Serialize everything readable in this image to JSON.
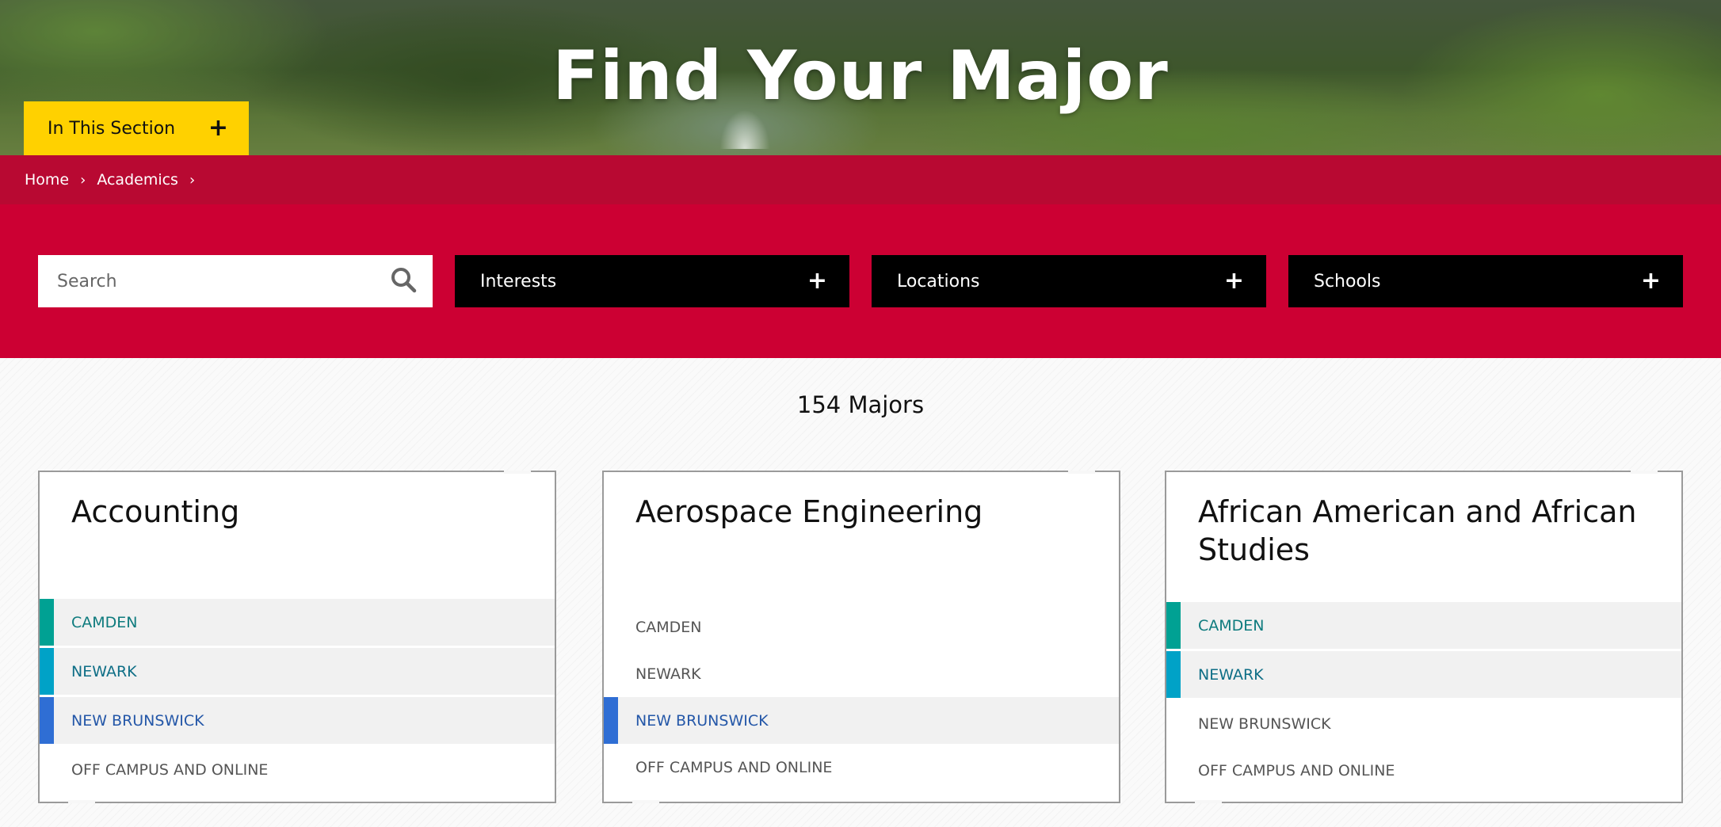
{
  "hero": {
    "title": "Find Your Major",
    "section_button_label": "In This Section",
    "section_button_icon": "plus-icon"
  },
  "breadcrumb": {
    "items": [
      "Home",
      "Academics"
    ],
    "separator_icon": "chevron-right-icon"
  },
  "filters": {
    "search_placeholder": "Search",
    "search_icon": "search-icon",
    "dropdowns": [
      {
        "label": "Interests",
        "icon": "plus-icon"
      },
      {
        "label": "Locations",
        "icon": "plus-icon"
      },
      {
        "label": "Schools",
        "icon": "plus-icon"
      }
    ]
  },
  "results": {
    "count_label": "154 Majors",
    "cards": [
      {
        "title": "Accounting",
        "locations": [
          {
            "label": "CAMDEN",
            "active": true
          },
          {
            "label": "NEWARK",
            "active": true
          },
          {
            "label": "NEW BRUNSWICK",
            "active": true
          },
          {
            "label": "OFF CAMPUS AND ONLINE",
            "active": false
          }
        ]
      },
      {
        "title": "Aerospace Engineering",
        "locations": [
          {
            "label": "CAMDEN",
            "active": false
          },
          {
            "label": "NEWARK",
            "active": false
          },
          {
            "label": "NEW BRUNSWICK",
            "active": true
          },
          {
            "label": "OFF CAMPUS AND ONLINE",
            "active": false
          }
        ]
      },
      {
        "title": "African American and African Studies",
        "locations": [
          {
            "label": "CAMDEN",
            "active": true
          },
          {
            "label": "NEWARK",
            "active": true
          },
          {
            "label": "NEW BRUNSWICK",
            "active": false
          },
          {
            "label": "OFF CAMPUS AND ONLINE",
            "active": false
          }
        ]
      }
    ]
  },
  "colors": {
    "brand_red": "#cc0033",
    "breadcrumb_red": "#b80932",
    "section_yellow": "#ffd100",
    "camden_teal": "#00a193",
    "newark_cyan": "#00a2c7",
    "new_brunswick_blue": "#2f6ed4"
  }
}
